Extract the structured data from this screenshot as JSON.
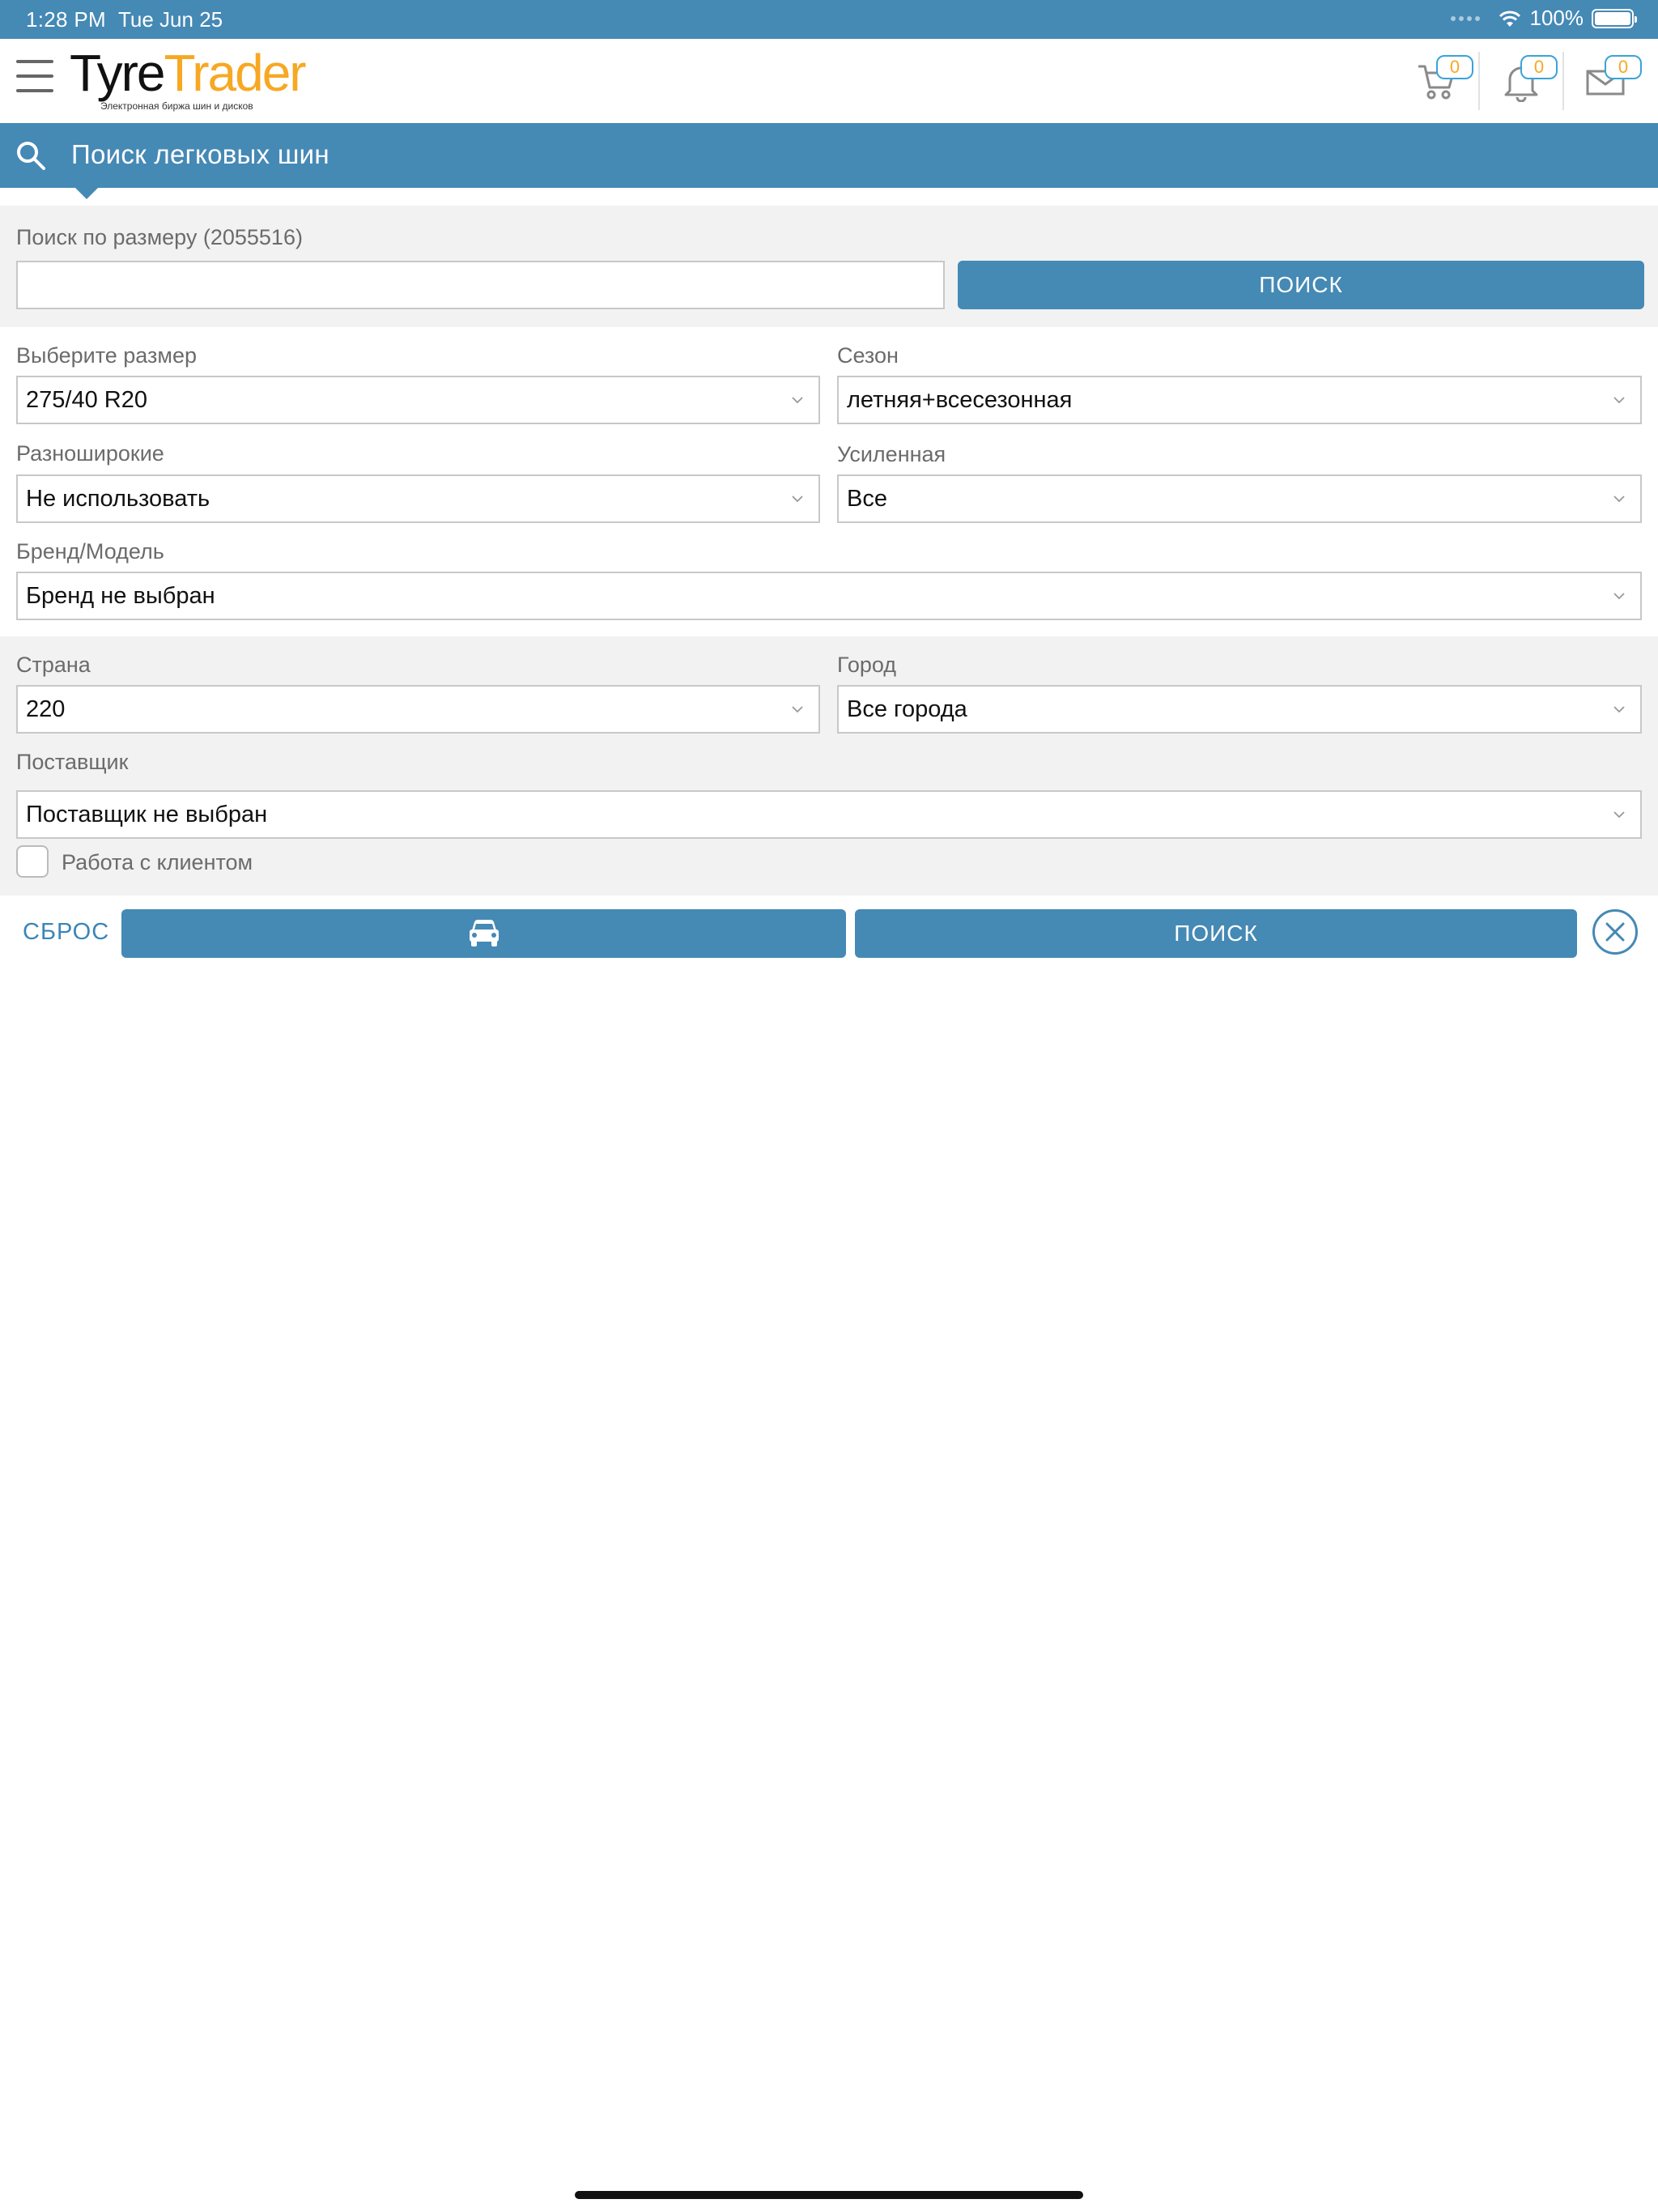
{
  "status_bar": {
    "time": "1:28 PM",
    "date": "Tue Jun 25",
    "battery": "100%"
  },
  "header": {
    "logo_tyre": "Tyre",
    "logo_trader": "Trader",
    "logo_tagline": "Электронная биржа шин и дисков",
    "cart_count": "0",
    "notifications_count": "0",
    "messages_count": "0"
  },
  "titlebar": {
    "title": "Поиск легковых шин"
  },
  "size_search": {
    "label": "Поиск по размеру (2055516)",
    "value": "",
    "button": "ПОИСК"
  },
  "filters": {
    "size_label": "Выберите размер",
    "size_value": "275/40 R20",
    "season_label": "Сезон",
    "season_value": "летняя+всесезонная",
    "staggered_label": "Разноширокие",
    "staggered_value": "Не использовать",
    "reinforced_label": "Усиленная",
    "reinforced_value": "Все",
    "brand_label": "Бренд/Модель",
    "brand_value": "Бренд не выбран"
  },
  "location": {
    "country_label": "Страна",
    "country_value": "220",
    "city_label": "Город",
    "city_value": "Все города",
    "supplier_label": "Поставщик",
    "supplier_value": "Поставщик не выбран",
    "client_work_label": "Работа с клиентом"
  },
  "actions": {
    "reset": "СБРОС",
    "search": "ПОИСК"
  },
  "colors": {
    "primary": "#4589b5",
    "accent": "#f7a823"
  }
}
